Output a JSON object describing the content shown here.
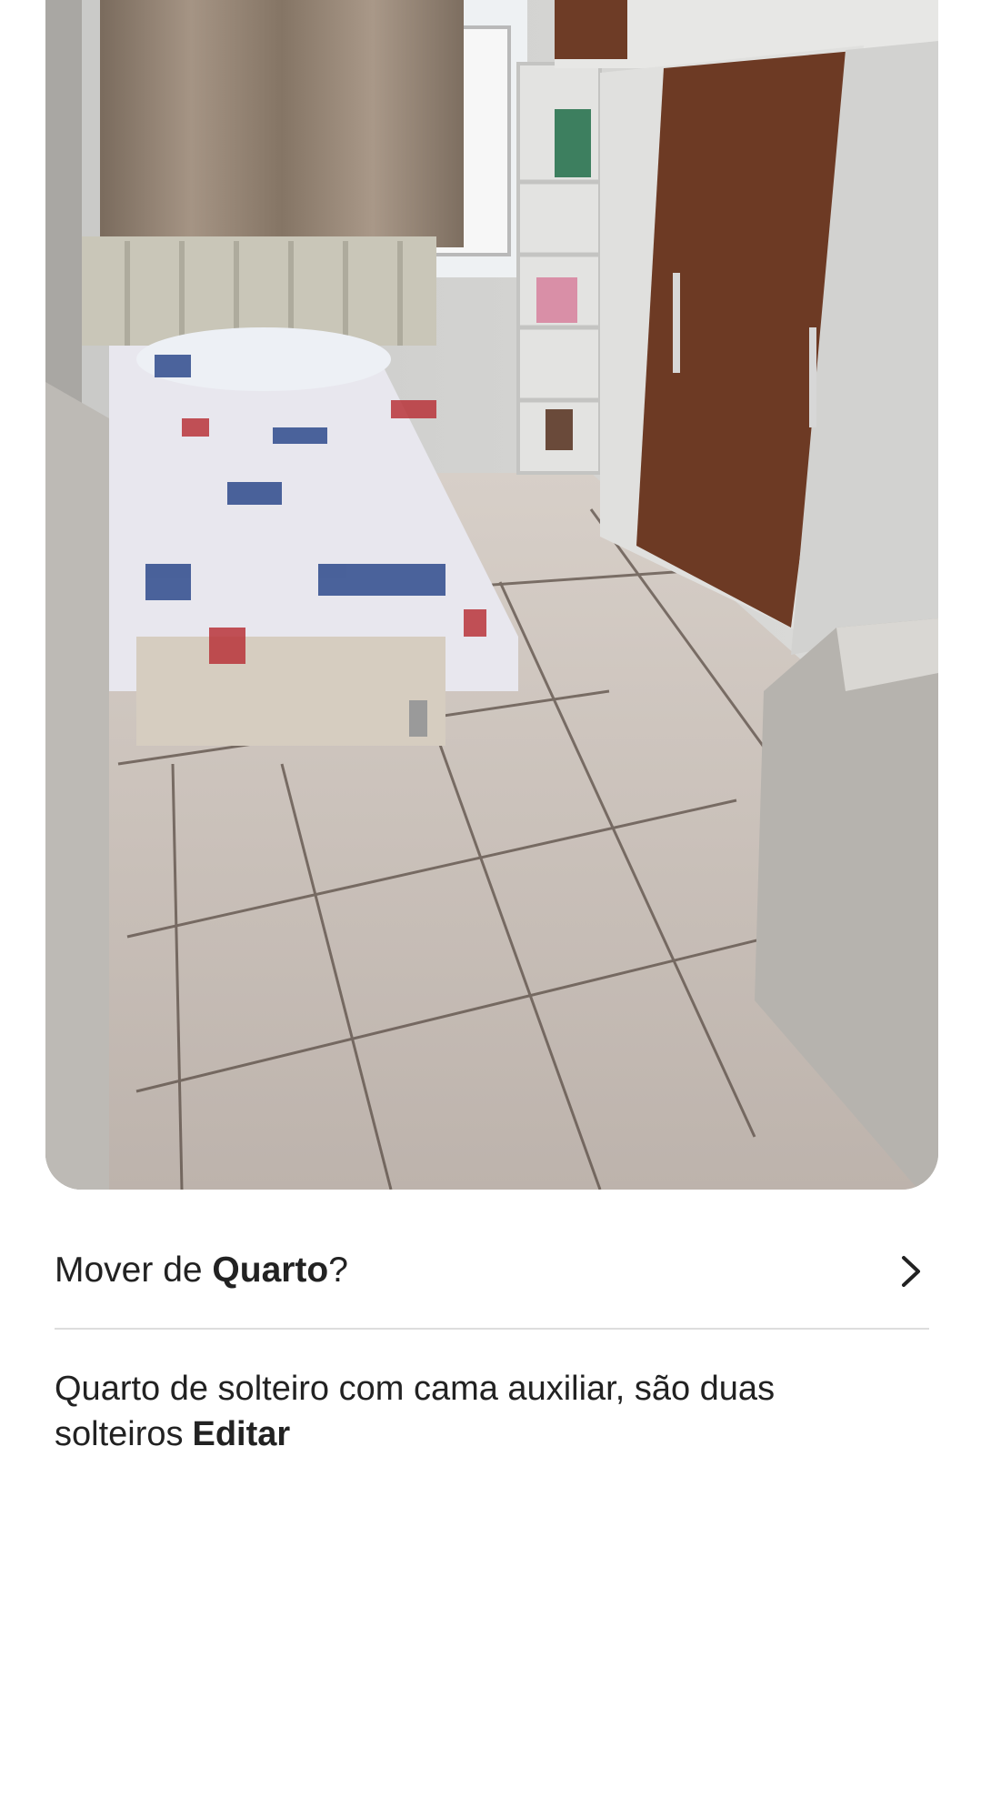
{
  "photo": {
    "alt_name": "room-photo"
  },
  "move_row": {
    "prefix": "Mover de ",
    "room_name": "Quarto",
    "suffix": "?",
    "icon": "chevron-right-icon"
  },
  "description": {
    "text": "Quarto de solteiro com cama auxiliar, são duas solteiros",
    "edit_label": "Editar"
  },
  "colors": {
    "text": "#222222",
    "divider": "#dddddd",
    "background": "#ffffff"
  }
}
